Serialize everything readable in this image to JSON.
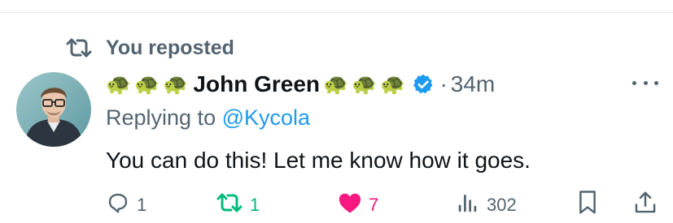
{
  "repost_banner": {
    "text": "You reposted",
    "icon": "repost-icon"
  },
  "tweet": {
    "author": {
      "name": "John Green",
      "emoji_before": [
        "🐢",
        "🐢",
        "🐢"
      ],
      "emoji_after": [
        "🐢",
        "🐢",
        "🐢"
      ],
      "verified": true,
      "avatar": "avatar-photo"
    },
    "separator": "·",
    "time": "34m",
    "replying_prefix": "Replying to",
    "replying_handle": "@Kycola",
    "text": "You can do this! Let me know how it goes."
  },
  "actions": {
    "replies": "1",
    "reposts": "1",
    "likes": "7",
    "views": "302"
  },
  "colors": {
    "muted": "#536471",
    "accent_blue": "#1d9bf0",
    "repost_green": "#00ba7c",
    "like_pink": "#f91880",
    "text": "#0f1419"
  }
}
